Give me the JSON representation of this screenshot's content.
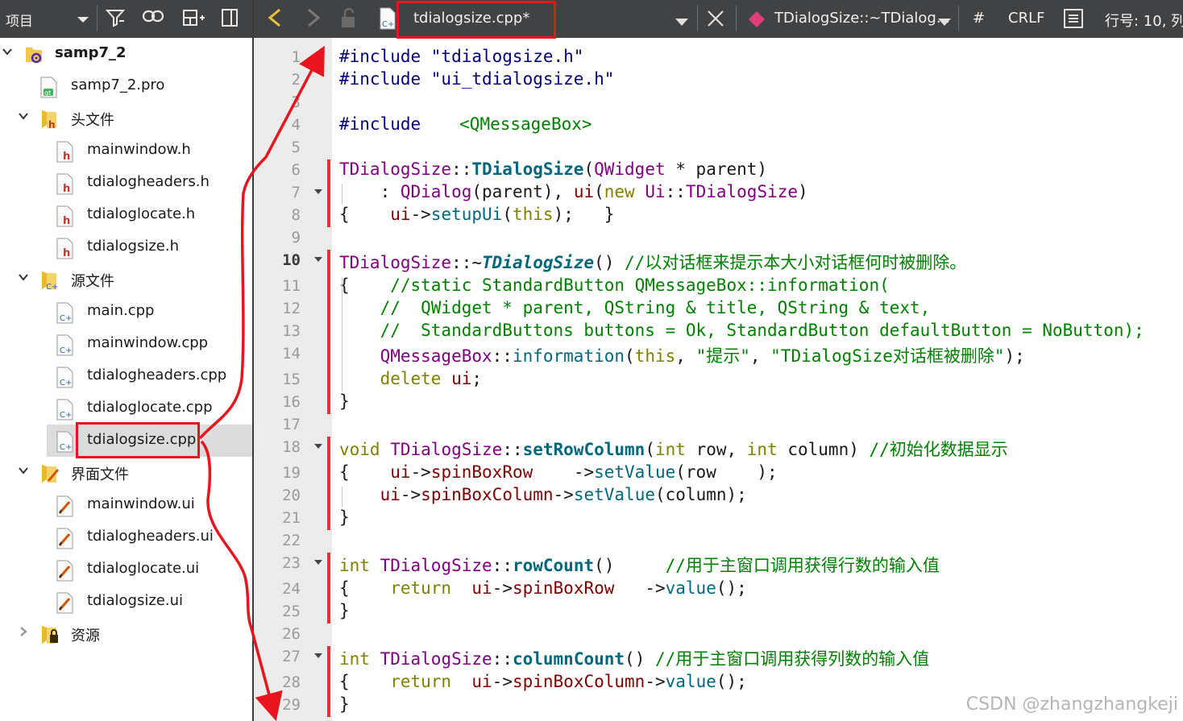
{
  "left_toolbar": {
    "label": "项目"
  },
  "tree": [
    {
      "label": "samp7_2",
      "kind": "project",
      "expanded": true,
      "bold": true
    },
    {
      "label": "samp7_2.pro",
      "kind": "pro"
    },
    {
      "label": "头文件",
      "kind": "folder-h",
      "expanded": true
    },
    {
      "label": "mainwindow.h",
      "kind": "h"
    },
    {
      "label": "tdialogheaders.h",
      "kind": "h"
    },
    {
      "label": "tdialoglocate.h",
      "kind": "h"
    },
    {
      "label": "tdialogsize.h",
      "kind": "h"
    },
    {
      "label": "源文件",
      "kind": "folder-cpp",
      "expanded": true
    },
    {
      "label": "main.cpp",
      "kind": "cpp"
    },
    {
      "label": "mainwindow.cpp",
      "kind": "cpp"
    },
    {
      "label": "tdialogheaders.cpp",
      "kind": "cpp"
    },
    {
      "label": "tdialoglocate.cpp",
      "kind": "cpp"
    },
    {
      "label": "tdialogsize.cpp",
      "kind": "cpp",
      "selected": true
    },
    {
      "label": "界面文件",
      "kind": "folder-ui",
      "expanded": true
    },
    {
      "label": "mainwindow.ui",
      "kind": "ui"
    },
    {
      "label": "tdialogheaders.ui",
      "kind": "ui"
    },
    {
      "label": "tdialoglocate.ui",
      "kind": "ui"
    },
    {
      "label": "tdialogsize.ui",
      "kind": "ui"
    },
    {
      "label": "资源",
      "kind": "folder-res",
      "expanded": false
    }
  ],
  "editor_toolbar": {
    "file_name": "tdialogsize.cpp*",
    "symbol": "TDialogSize::~TDialog...",
    "hash": "#",
    "line_ending": "CRLF",
    "position": "行号: 10, 列"
  },
  "line_numbers": [
    "1",
    "2",
    "3",
    "4",
    "5",
    "6",
    "7",
    "8",
    "9",
    "10",
    "11",
    "12",
    "13",
    "14",
    "15",
    "16",
    "17",
    "18",
    "19",
    "20",
    "21",
    "22",
    "23",
    "24",
    "25",
    "26",
    "27",
    "28",
    "29"
  ],
  "current_line": "10",
  "code": {
    "l1": "#include \"tdialogsize.h\"",
    "l2": "#include \"ui_tdialogsize.h\"",
    "l4a": "#include",
    "l4b": "<QMessageBox>",
    "l6": [
      "TDialogSize",
      "::",
      "TDialogSize",
      "(",
      "QWidget",
      " * parent)"
    ],
    "l7": [
      "    : ",
      "QDialog",
      "(parent), ",
      "ui",
      "(",
      "new",
      " ",
      "Ui",
      "::",
      "TDialogSize",
      ")"
    ],
    "l8": [
      "{    ",
      "ui",
      "->",
      "setupUi",
      "(",
      "this",
      ");   }"
    ],
    "l10": [
      "TDialogSize",
      "::~",
      "TDialogSize",
      "() ",
      "//以对话框来提示本大小对话框何时被删除。"
    ],
    "l11": [
      "{    ",
      "//static StandardButton QMessageBox::information("
    ],
    "l12": "    //  QWidget * parent, QString & title, QString & text,",
    "l13": "    //  StandardButtons buttons = Ok, StandardButton defaultButton = NoButton);",
    "l14": [
      "    ",
      "QMessageBox",
      "::",
      "information",
      "(",
      "this",
      ", ",
      "\"提示\"",
      ", ",
      "\"TDialogSize对话框被删除\"",
      ");"
    ],
    "l15": [
      "    ",
      "delete",
      " ",
      "ui",
      ";"
    ],
    "l16": "}",
    "l18": [
      "void",
      " ",
      "TDialogSize",
      "::",
      "setRowColumn",
      "(",
      "int",
      " row, ",
      "int",
      " column) ",
      "//初始化数据显示"
    ],
    "l19": [
      "{    ",
      "ui",
      "->",
      "spinBoxRow",
      "    ->",
      "setValue",
      "(row    );"
    ],
    "l20": [
      "    ",
      "ui",
      "->",
      "spinBoxColumn",
      "->",
      "setValue",
      "(column);"
    ],
    "l21": "}",
    "l23": [
      "int",
      " ",
      "TDialogSize",
      "::",
      "rowCount",
      "()     ",
      "//用于主窗口调用获得行数的输入值"
    ],
    "l24": [
      "{    ",
      "return",
      "  ",
      "ui",
      "->",
      "spinBoxRow",
      "   ->",
      "value",
      "();"
    ],
    "l25": "}",
    "l27": [
      "int",
      " ",
      "TDialogSize",
      "::",
      "columnCount",
      "() ",
      "//用于主窗口调用获得列数的输入值"
    ],
    "l28": [
      "{    ",
      "return",
      "  ",
      "ui",
      "->",
      "spinBoxColumn",
      "->",
      "value",
      "();"
    ],
    "l29": "}"
  },
  "watermark": "CSDN @zhangzhangkeji",
  "colors": {
    "annotation": "#e8141e",
    "toolbar": "#404244",
    "selection": "#dcdcdc"
  }
}
